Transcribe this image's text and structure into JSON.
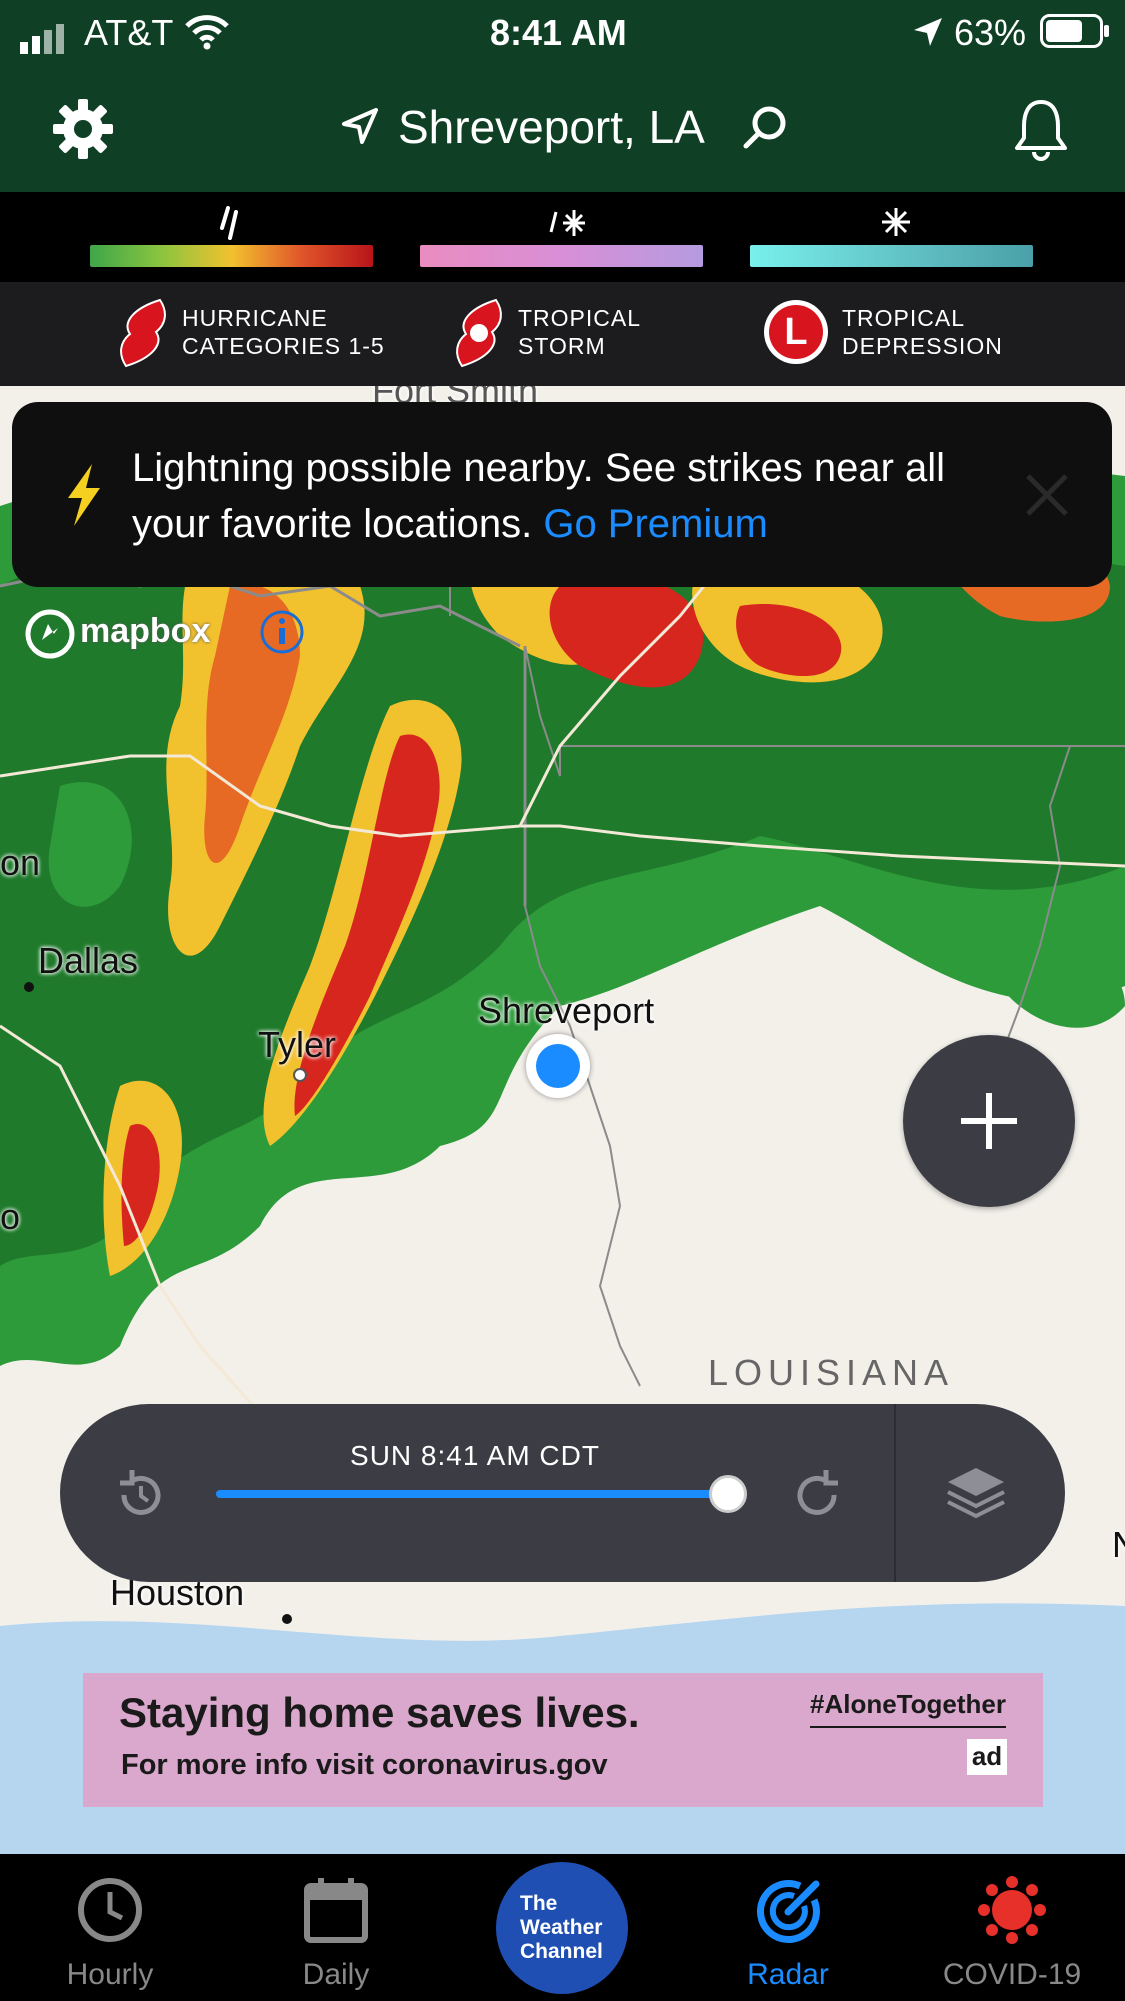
{
  "status_bar": {
    "carrier": "AT&T",
    "time": "8:41 AM",
    "battery": "63%"
  },
  "header": {
    "location": "Shreveport, LA",
    "icons": [
      "gear-icon",
      "location-arrow-icon",
      "search-icon",
      "bell-icon"
    ]
  },
  "legend": {
    "precip_icons": [
      "rain-icon",
      "mix-icon",
      "snow-icon"
    ],
    "storms": [
      {
        "label_line1": "HURRICANE",
        "label_line2": "CATEGORIES 1-5"
      },
      {
        "label_line1": "TROPICAL",
        "label_line2": "STORM"
      },
      {
        "label_line1": "TROPICAL",
        "label_line2": "DEPRESSION"
      }
    ],
    "depression_letter": "L"
  },
  "banner": {
    "text": "Lightning possible nearby. See strikes near all your favorite locations.",
    "link": "Go Premium"
  },
  "map": {
    "attribution": "mapbox",
    "cities": {
      "fort_smith": "Fort Smith",
      "dallas": "Dallas",
      "tyler": "Tyler",
      "shreveport": "Shreveport",
      "houston": "Houston",
      "louisiana": "LOUISIANA",
      "edge_left_1": "on",
      "edge_left_2": "o",
      "edge_right": "N"
    }
  },
  "timeline": {
    "timestamp": "SUN 8:41 AM CDT",
    "progress": 1.0
  },
  "ad": {
    "headline": "Staying home saves lives.",
    "subline": "For more info visit coronavirus.gov",
    "hashtag": "#AloneTogether",
    "badge": "ad"
  },
  "nav": {
    "items": [
      {
        "label": "Hourly"
      },
      {
        "label": "Daily"
      },
      {
        "label": "Radar"
      },
      {
        "label": "COVID-19"
      }
    ],
    "center_logo": [
      "The",
      "Weather",
      "Channel"
    ]
  },
  "colors": {
    "header_green": "#0f3f24",
    "accent_blue": "#1a8cff",
    "covid_red": "#e8302a"
  }
}
